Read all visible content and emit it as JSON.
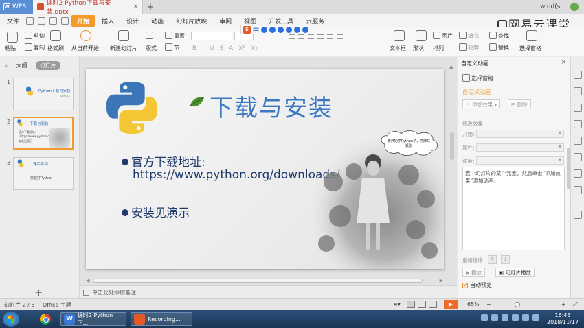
{
  "titlebar": {
    "app_tab": "WPS",
    "doc_tab": "课时2 Python下载与安装.pptx",
    "user": "wind(s..."
  },
  "brand": "网易云课堂",
  "menu": {
    "file": "文件",
    "items": [
      {
        "label": "开始",
        "active": true
      },
      {
        "label": "插入"
      },
      {
        "label": "设计"
      },
      {
        "label": "动画"
      },
      {
        "label": "幻灯片放映"
      },
      {
        "label": "审阅"
      },
      {
        "label": "视图"
      },
      {
        "label": "开发工具"
      },
      {
        "label": "云服务"
      }
    ]
  },
  "ribbon": {
    "paste": "粘贴",
    "cut": "剪切",
    "copy": "复制",
    "format_painter": "格式刷",
    "from_current": "从当前开始",
    "new_slide": "新建幻灯片",
    "layout": "版式",
    "section": "节",
    "reset": "重置",
    "textbox": "文本框",
    "shape": "形状",
    "arrange": "排列",
    "picture": "图片",
    "fill": "填充",
    "outline": "轮廓",
    "find": "查找",
    "replace": "替换",
    "select_pane": "选择窗格"
  },
  "float_toolbar": {
    "cn": "中"
  },
  "left_pane": {
    "tab_outline": "大纲",
    "tab_slides": "幻灯片",
    "slides": [
      {
        "num": "1",
        "title": "Python下载与安装",
        "sub": "Python"
      },
      {
        "num": "2",
        "title": "下载与安装",
        "line1": "官方下载地址:",
        "line2": "https://www.python.org/downloads/",
        "line3": "安装见演示"
      },
      {
        "num": "3",
        "title": "课后练习",
        "sub": "安装好Python"
      }
    ]
  },
  "slide": {
    "title": "下载与安装",
    "bullet1": "官方下载地址:",
    "url": "https://www.python.org/downloads/",
    "bullet2": "安装见演示",
    "bubble": "要开始学Python了，停麻又紧张"
  },
  "notes": {
    "placeholder": "单击此处添加备注"
  },
  "task_pane": {
    "title": "自定义动画",
    "select_pane": "选择窗格",
    "heading": "自定义动画",
    "add_effect": "添加效果",
    "delete": "删除",
    "modify": "修改效果",
    "start_label": "开始:",
    "property_label": "属性:",
    "speed_label": "速度:",
    "list_hint": "选中幻灯片的某个元素，然后单击“添加效果”添加动画。",
    "reorder": "重新排序",
    "play": "播放",
    "slideshow": "幻灯片播放",
    "autopreview": "自动预览"
  },
  "status": {
    "slide_info": "幻灯片 2 / 3",
    "theme": "Office 主题",
    "zoom": "65%"
  },
  "taskbar": {
    "app1": "课时2 Python下...",
    "app2": "Recording...",
    "time": "16:43",
    "date": "2018/11/17"
  },
  "colors": {
    "accent": "#f29a2c",
    "title_blue": "#3a78c2",
    "bullet_navy": "#1f3a6b",
    "wps_blue": "#5a8fd6"
  }
}
